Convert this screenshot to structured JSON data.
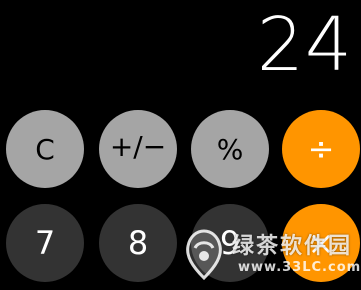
{
  "display": {
    "value": "24"
  },
  "keys": {
    "clear": "C",
    "sign": "+/−",
    "percent": "%",
    "divide": "÷",
    "seven": "7",
    "eight": "8",
    "nine": "9",
    "multiply": "×"
  },
  "colors": {
    "background": "#000000",
    "function_key": "#a5a5a5",
    "operator_key": "#ff9500",
    "number_key": "#333333"
  },
  "watermark": {
    "title": "绿茶软件园",
    "url": "www.33LC.com"
  }
}
